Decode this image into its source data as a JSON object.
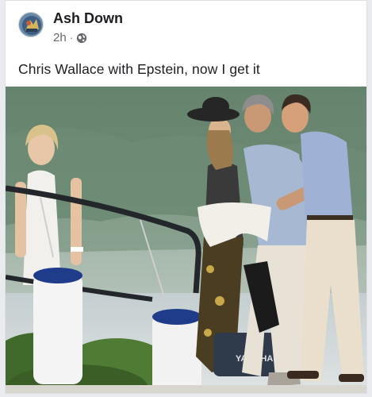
{
  "post": {
    "author_name": "Ash Down",
    "timestamp": "2h",
    "separator": "·",
    "privacy_icon": "globe-icon",
    "text": "Chris Wallace with Epstein, now I get it"
  },
  "photo": {
    "boat_brand_text": "YAMAHA"
  },
  "colors": {
    "author_text": "#1c1e21",
    "meta_text": "#65676b",
    "card_bg": "#ffffff",
    "page_bg": "#e9ebee"
  }
}
